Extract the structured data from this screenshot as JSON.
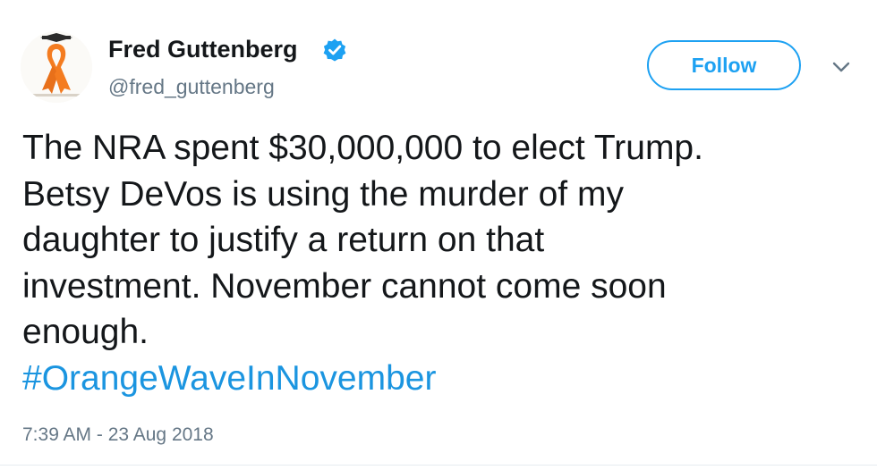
{
  "author": {
    "display_name": "Fred Guttenberg",
    "handle": "@fred_guttenberg",
    "verified": true,
    "avatar_icon": "orange-ribbon-icon"
  },
  "actions": {
    "follow_label": "Follow",
    "more_icon": "chevron-down-icon"
  },
  "tweet": {
    "lines": [
      "The NRA spent $30,000,000 to elect Trump.",
      "Betsy DeVos is using the murder of my",
      "daughter to justify a return on that",
      "investment.  November cannot come soon",
      "enough."
    ],
    "hashtag": "#OrangeWaveInNovember",
    "timestamp": "7:39 AM - 23 Aug 2018"
  },
  "colors": {
    "accent": "#1da1f2",
    "hashtag": "#1b95e0",
    "text": "#14171a",
    "secondary_text": "#657786",
    "ribbon": "#f47c20"
  }
}
